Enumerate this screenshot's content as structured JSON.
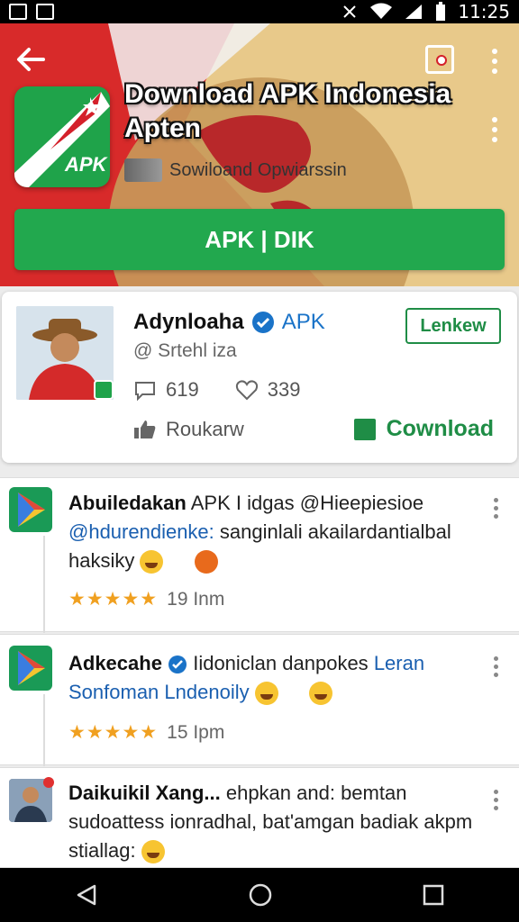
{
  "status_bar": {
    "time": "11:25"
  },
  "header": {
    "app_title": "Download APK Indonesia Apten",
    "app_subtitle": "Sowiloand Opwiarssin",
    "icon_label": "APK",
    "download_button": "APK | DIK"
  },
  "profile": {
    "name": "Adynloaha",
    "name_tag": "APK",
    "handle": "@ Srtehl iza",
    "comments": "619",
    "likes": "339",
    "follow_button": "Lenkew",
    "like_action": "Roukarw",
    "download_action": "Cownload"
  },
  "posts": [
    {
      "author": "Abuiledakan",
      "text": "APK I idgas @Hieepiesioe",
      "mention": "@hdurendienke:",
      "text2": "sanginlali akailardantialbal haksiky",
      "stars": "★★★★★",
      "time": "19 Inm"
    },
    {
      "author": "Adkecahe",
      "text": "Iidoniclan danpokes",
      "link": "Leran Sonfoman Lndenoily",
      "stars": "★★★★★",
      "time": "15 Ipm"
    },
    {
      "author": "Daikuikil Xang...",
      "text": "ehpkan and: bemtan sudoattess ionradhal, bat'amgan badiak akpm stiallag:"
    }
  ],
  "colors": {
    "brand_red": "#d4202a",
    "brand_green": "#22a84e",
    "link_blue": "#1a73c8"
  }
}
